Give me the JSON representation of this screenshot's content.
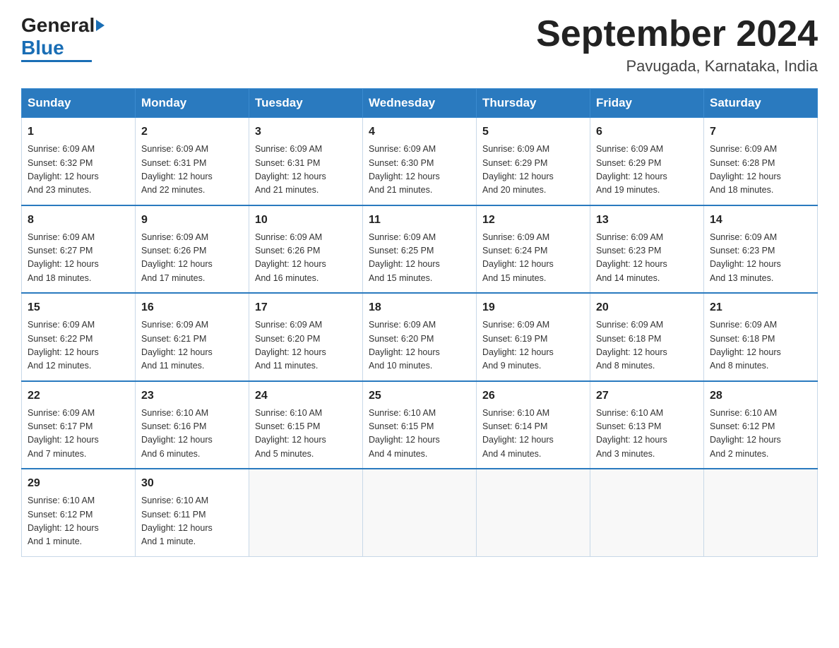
{
  "header": {
    "logo_general": "General",
    "logo_blue": "Blue",
    "calendar_title": "September 2024",
    "calendar_subtitle": "Pavugada, Karnataka, India"
  },
  "weekdays": [
    "Sunday",
    "Monday",
    "Tuesday",
    "Wednesday",
    "Thursday",
    "Friday",
    "Saturday"
  ],
  "weeks": [
    [
      {
        "day": "1",
        "sunrise": "6:09 AM",
        "sunset": "6:32 PM",
        "daylight": "12 hours and 23 minutes."
      },
      {
        "day": "2",
        "sunrise": "6:09 AM",
        "sunset": "6:31 PM",
        "daylight": "12 hours and 22 minutes."
      },
      {
        "day": "3",
        "sunrise": "6:09 AM",
        "sunset": "6:31 PM",
        "daylight": "12 hours and 21 minutes."
      },
      {
        "day": "4",
        "sunrise": "6:09 AM",
        "sunset": "6:30 PM",
        "daylight": "12 hours and 21 minutes."
      },
      {
        "day": "5",
        "sunrise": "6:09 AM",
        "sunset": "6:29 PM",
        "daylight": "12 hours and 20 minutes."
      },
      {
        "day": "6",
        "sunrise": "6:09 AM",
        "sunset": "6:29 PM",
        "daylight": "12 hours and 19 minutes."
      },
      {
        "day": "7",
        "sunrise": "6:09 AM",
        "sunset": "6:28 PM",
        "daylight": "12 hours and 18 minutes."
      }
    ],
    [
      {
        "day": "8",
        "sunrise": "6:09 AM",
        "sunset": "6:27 PM",
        "daylight": "12 hours and 18 minutes."
      },
      {
        "day": "9",
        "sunrise": "6:09 AM",
        "sunset": "6:26 PM",
        "daylight": "12 hours and 17 minutes."
      },
      {
        "day": "10",
        "sunrise": "6:09 AM",
        "sunset": "6:26 PM",
        "daylight": "12 hours and 16 minutes."
      },
      {
        "day": "11",
        "sunrise": "6:09 AM",
        "sunset": "6:25 PM",
        "daylight": "12 hours and 15 minutes."
      },
      {
        "day": "12",
        "sunrise": "6:09 AM",
        "sunset": "6:24 PM",
        "daylight": "12 hours and 15 minutes."
      },
      {
        "day": "13",
        "sunrise": "6:09 AM",
        "sunset": "6:23 PM",
        "daylight": "12 hours and 14 minutes."
      },
      {
        "day": "14",
        "sunrise": "6:09 AM",
        "sunset": "6:23 PM",
        "daylight": "12 hours and 13 minutes."
      }
    ],
    [
      {
        "day": "15",
        "sunrise": "6:09 AM",
        "sunset": "6:22 PM",
        "daylight": "12 hours and 12 minutes."
      },
      {
        "day": "16",
        "sunrise": "6:09 AM",
        "sunset": "6:21 PM",
        "daylight": "12 hours and 11 minutes."
      },
      {
        "day": "17",
        "sunrise": "6:09 AM",
        "sunset": "6:20 PM",
        "daylight": "12 hours and 11 minutes."
      },
      {
        "day": "18",
        "sunrise": "6:09 AM",
        "sunset": "6:20 PM",
        "daylight": "12 hours and 10 minutes."
      },
      {
        "day": "19",
        "sunrise": "6:09 AM",
        "sunset": "6:19 PM",
        "daylight": "12 hours and 9 minutes."
      },
      {
        "day": "20",
        "sunrise": "6:09 AM",
        "sunset": "6:18 PM",
        "daylight": "12 hours and 8 minutes."
      },
      {
        "day": "21",
        "sunrise": "6:09 AM",
        "sunset": "6:18 PM",
        "daylight": "12 hours and 8 minutes."
      }
    ],
    [
      {
        "day": "22",
        "sunrise": "6:09 AM",
        "sunset": "6:17 PM",
        "daylight": "12 hours and 7 minutes."
      },
      {
        "day": "23",
        "sunrise": "6:10 AM",
        "sunset": "6:16 PM",
        "daylight": "12 hours and 6 minutes."
      },
      {
        "day": "24",
        "sunrise": "6:10 AM",
        "sunset": "6:15 PM",
        "daylight": "12 hours and 5 minutes."
      },
      {
        "day": "25",
        "sunrise": "6:10 AM",
        "sunset": "6:15 PM",
        "daylight": "12 hours and 4 minutes."
      },
      {
        "day": "26",
        "sunrise": "6:10 AM",
        "sunset": "6:14 PM",
        "daylight": "12 hours and 4 minutes."
      },
      {
        "day": "27",
        "sunrise": "6:10 AM",
        "sunset": "6:13 PM",
        "daylight": "12 hours and 3 minutes."
      },
      {
        "day": "28",
        "sunrise": "6:10 AM",
        "sunset": "6:12 PM",
        "daylight": "12 hours and 2 minutes."
      }
    ],
    [
      {
        "day": "29",
        "sunrise": "6:10 AM",
        "sunset": "6:12 PM",
        "daylight": "12 hours and 1 minute."
      },
      {
        "day": "30",
        "sunrise": "6:10 AM",
        "sunset": "6:11 PM",
        "daylight": "12 hours and 1 minute."
      },
      null,
      null,
      null,
      null,
      null
    ]
  ],
  "labels": {
    "sunrise": "Sunrise:",
    "sunset": "Sunset:",
    "daylight": "Daylight:"
  }
}
